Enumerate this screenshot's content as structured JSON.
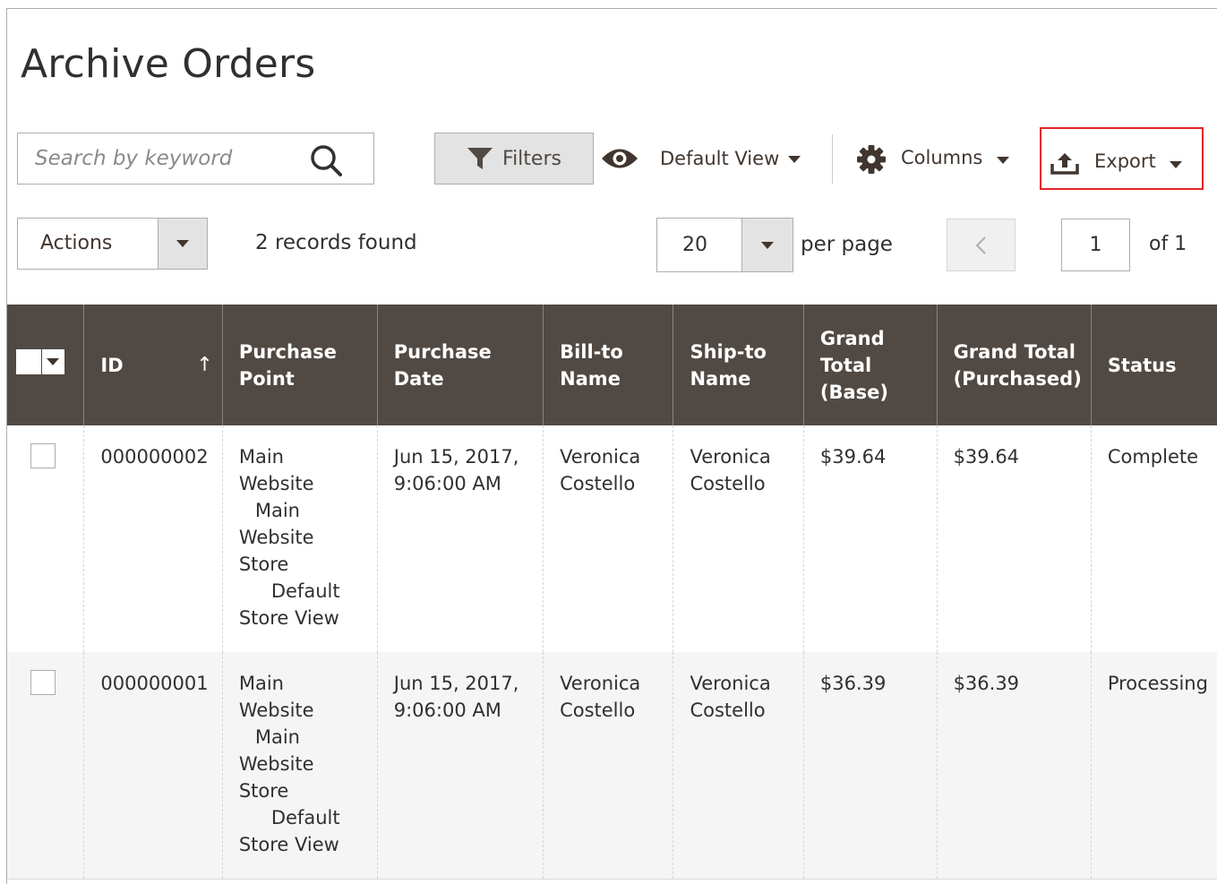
{
  "page": {
    "title": "Archive Orders"
  },
  "toolbar": {
    "search_placeholder": "Search by keyword",
    "filters_label": "Filters",
    "view_label": "Default View",
    "columns_label": "Columns",
    "export_label": "Export",
    "highlight_color": "#e22626"
  },
  "paging": {
    "actions_label": "Actions",
    "records_found": "2 records found",
    "per_page_value": "20",
    "per_page_label": "per page",
    "current_page": "1",
    "total_pages_label": "of 1"
  },
  "table": {
    "header_bg": "#514943",
    "columns": {
      "id": "ID",
      "purchase_point": [
        "Purchase",
        "Point"
      ],
      "purchase_date": [
        "Purchase",
        "Date"
      ],
      "bill_to": [
        "Bill-to",
        "Name"
      ],
      "ship_to": [
        "Ship-to",
        "Name"
      ],
      "grand_total_base": [
        "Grand",
        "Total",
        "(Base)"
      ],
      "grand_total_purchased": [
        "Grand Total",
        "(Purchased)"
      ],
      "status": "Status"
    },
    "sort_arrow": "↑",
    "rows": [
      {
        "id": "000000002",
        "purchase_point": [
          "Main",
          "Website",
          "Main",
          "Website",
          "Store",
          "Default",
          "Store View"
        ],
        "purchase_date": [
          "Jun 15, 2017,",
          "9:06:00 AM"
        ],
        "bill_to": [
          "Veronica",
          "Costello"
        ],
        "ship_to": [
          "Veronica",
          "Costello"
        ],
        "grand_total_base": "$39.64",
        "grand_total_purchased": "$39.64",
        "status": "Complete"
      },
      {
        "id": "000000001",
        "purchase_point": [
          "Main",
          "Website",
          "Main",
          "Website",
          "Store",
          "Default",
          "Store View"
        ],
        "purchase_date": [
          "Jun 15, 2017,",
          "9:06:00 AM"
        ],
        "bill_to": [
          "Veronica",
          "Costello"
        ],
        "ship_to": [
          "Veronica",
          "Costello"
        ],
        "grand_total_base": "$36.39",
        "grand_total_purchased": "$36.39",
        "status": "Processing"
      }
    ]
  }
}
